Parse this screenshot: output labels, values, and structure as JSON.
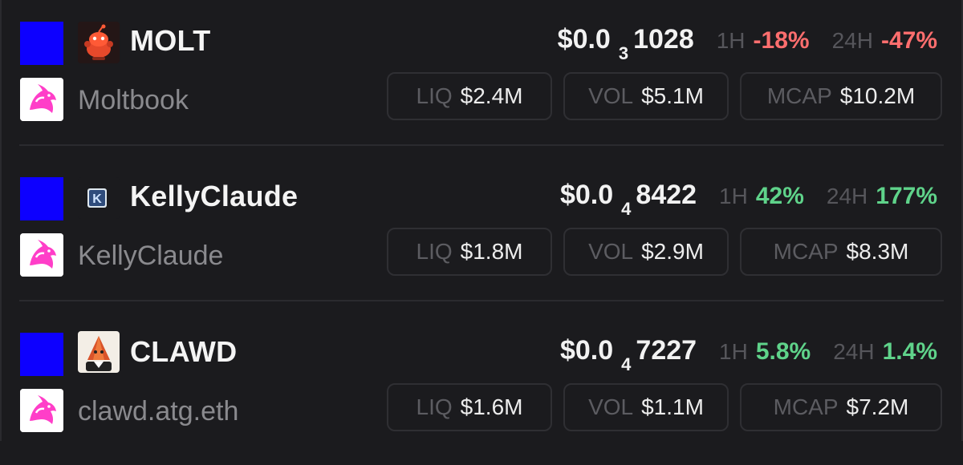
{
  "tokens": [
    {
      "symbol": "MOLT",
      "name": "Moltbook",
      "logo_icon": "reddit-snoo-icon",
      "dex_icon": "uniswap-unicorn-icon",
      "price_prefix": "$0.0",
      "price_zeros": "3",
      "price_digits": "1028",
      "h1_label": "1H",
      "h1_change": "-18%",
      "h24_label": "24H",
      "h24_change": "-47%",
      "liq_label": "LIQ",
      "liq_value": "$2.4M",
      "vol_label": "VOL",
      "vol_value": "$5.1M",
      "mcap_label": "MCAP",
      "mcap_value": "$10.2M"
    },
    {
      "symbol": "KellyClaude",
      "name": "KellyClaude",
      "logo_icon": "k-letter-icon",
      "dex_icon": "uniswap-unicorn-icon",
      "price_prefix": "$0.0",
      "price_zeros": "4",
      "price_digits": "8422",
      "h1_label": "1H",
      "h1_change": "42%",
      "h24_label": "24H",
      "h24_change": "177%",
      "liq_label": "LIQ",
      "liq_value": "$1.8M",
      "vol_label": "VOL",
      "vol_value": "$2.9M",
      "mcap_label": "MCAP",
      "mcap_value": "$8.3M"
    },
    {
      "symbol": "CLAWD",
      "name": "clawd.atg.eth",
      "logo_icon": "lobster-character-icon",
      "dex_icon": "uniswap-unicorn-icon",
      "price_prefix": "$0.0",
      "price_zeros": "4",
      "price_digits": "7227",
      "h1_label": "1H",
      "h1_change": "5.8%",
      "h24_label": "24H",
      "h24_change": "1.4%",
      "liq_label": "LIQ",
      "liq_value": "$1.6M",
      "vol_label": "VOL",
      "vol_value": "$1.1M",
      "mcap_label": "MCAP",
      "mcap_value": "$7.2M"
    }
  ],
  "colors": {
    "background": "#1b1b1e",
    "chain_square": "#0d00ff",
    "negative": "#ff6e6e",
    "positive": "#5fd38a",
    "muted_label": "#56565b",
    "dex_pink": "#ff3ec8"
  }
}
